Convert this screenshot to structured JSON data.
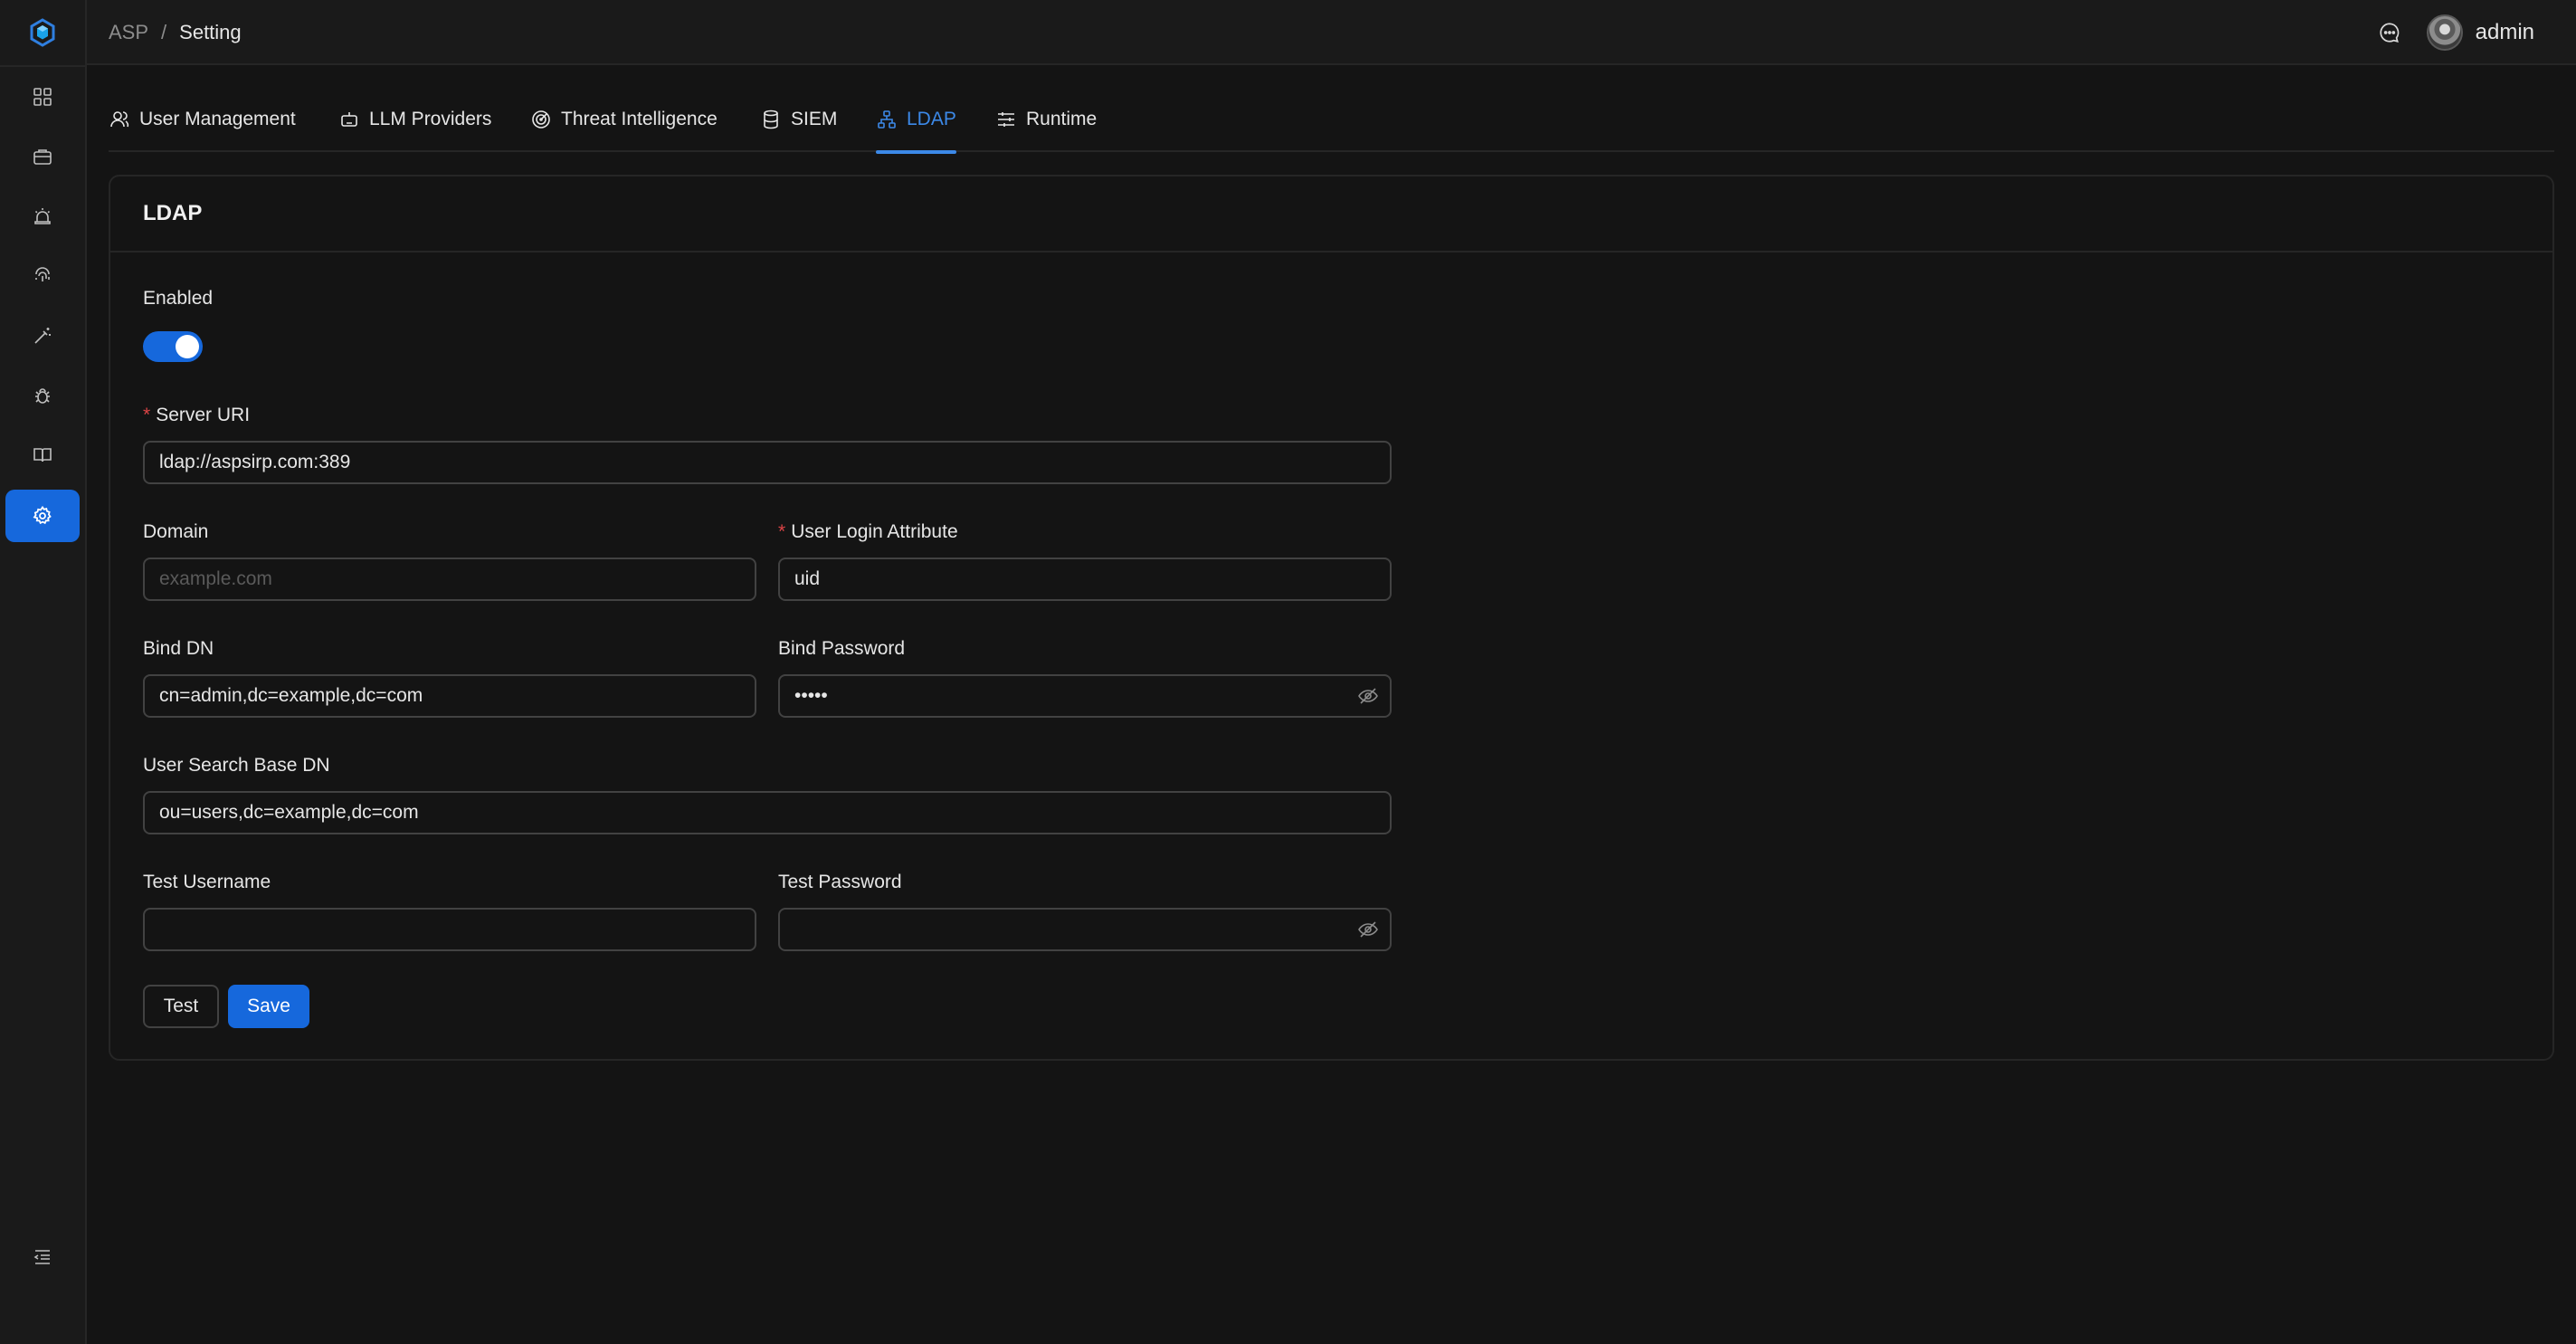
{
  "breadcrumb": {
    "root": "ASP",
    "separator": "/",
    "current": "Setting"
  },
  "header": {
    "user_name": "admin"
  },
  "sidebar": {
    "items": [
      {
        "icon": "dashboard-icon"
      },
      {
        "icon": "briefcase-icon"
      },
      {
        "icon": "alarm-icon"
      },
      {
        "icon": "fingerprint-icon"
      },
      {
        "icon": "magic-wand-icon"
      },
      {
        "icon": "bug-icon"
      },
      {
        "icon": "book-icon"
      },
      {
        "icon": "gear-icon",
        "active": true
      }
    ],
    "collapse_icon": "menu-fold-icon"
  },
  "tabs": [
    {
      "label": "User Management",
      "icon": "user-icon"
    },
    {
      "label": "LLM Providers",
      "icon": "robot-icon"
    },
    {
      "label": "Threat Intelligence",
      "icon": "radar-icon"
    },
    {
      "label": "SIEM",
      "icon": "database-icon"
    },
    {
      "label": "LDAP",
      "icon": "cluster-icon",
      "active": true
    },
    {
      "label": "Runtime",
      "icon": "sliders-icon"
    }
  ],
  "card": {
    "title": "LDAP"
  },
  "form": {
    "enabled": {
      "label": "Enabled",
      "value": true
    },
    "server_uri": {
      "label": "Server URI",
      "required": "*",
      "value": "ldap://aspsirp.com:389",
      "placeholder": ""
    },
    "domain": {
      "label": "Domain",
      "value": "",
      "placeholder": "example.com"
    },
    "user_login_attribute": {
      "label": "User Login Attribute",
      "required": "*",
      "value": "uid",
      "placeholder": ""
    },
    "bind_dn": {
      "label": "Bind DN",
      "value": "cn=admin,dc=example,dc=com",
      "placeholder": ""
    },
    "bind_password": {
      "label": "Bind Password",
      "value": "•••••",
      "placeholder": ""
    },
    "user_search_base_dn": {
      "label": "User Search Base DN",
      "value": "ou=users,dc=example,dc=com",
      "placeholder": ""
    },
    "test_username": {
      "label": "Test Username",
      "value": "",
      "placeholder": ""
    },
    "test_password": {
      "label": "Test Password",
      "value": "",
      "placeholder": ""
    }
  },
  "buttons": {
    "test": "Test",
    "save": "Save"
  },
  "colors": {
    "accent": "#1668dc",
    "tab_active": "#3c89e8",
    "required": "#dc4446",
    "background": "#141414"
  }
}
